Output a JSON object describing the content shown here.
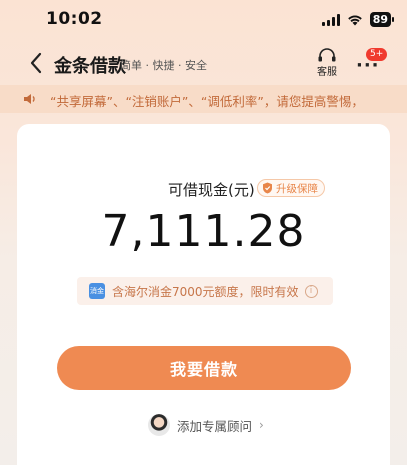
{
  "status_bar": {
    "time": "10:02",
    "battery": "89"
  },
  "nav": {
    "title": "金条借款",
    "subtitle": "简单 · 快捷 · 安全",
    "service_label": "客服",
    "more_badge": "5+"
  },
  "notice": {
    "text": "“共享屏幕”、“注销账户”、“调低利率”，请您提高警惕，"
  },
  "card": {
    "amount_label": "可借现金(元)",
    "upgrade_badge": "升级保障",
    "amount": "7,111.28",
    "quota_logo": "消金",
    "quota_text": "含海尔消金7000元额度，限时有效",
    "borrow_button": "我要借款",
    "advisor_text": "添加专属顾问"
  },
  "colors": {
    "accent": "#ef8a52",
    "notice_text": "#c26a3a",
    "badge": "#f03a2e"
  }
}
